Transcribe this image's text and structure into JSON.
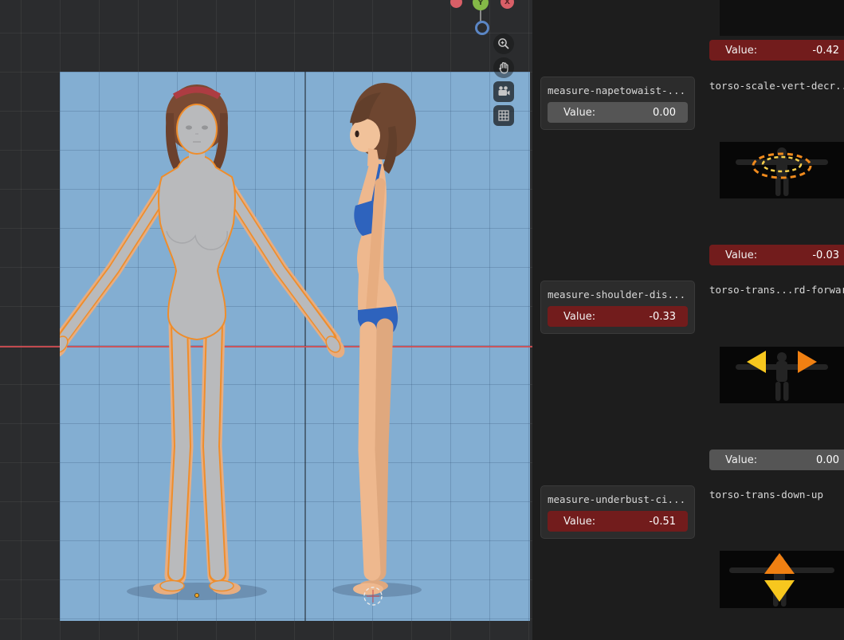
{
  "viewport": {
    "gizmo": {
      "y_label": "Y",
      "x_label": "X"
    },
    "tools": {
      "zoom": "zoom-in-icon",
      "pan": "hand-icon",
      "camera": "camera-icon",
      "grid": "grid-icon"
    }
  },
  "panels": {
    "left_column": [
      {
        "title": "measure-napetowaist-...",
        "value_label": "Value:",
        "value": "0.00",
        "state": "default"
      },
      {
        "title": "measure-shoulder-dis...",
        "value_label": "Value:",
        "value": "-0.33",
        "state": "modified"
      },
      {
        "title": "measure-underbust-ci...",
        "value_label": "Value:",
        "value": "-0.51",
        "state": "modified"
      }
    ],
    "right_column": {
      "top_slider": {
        "value_label": "Value:",
        "value": "-0.42",
        "state": "modified"
      },
      "sections": [
        {
          "title": "torso-scale-vert-decr...",
          "value_label": "Value:",
          "value": "-0.03",
          "state": "modified",
          "thumbnail": "torso-scale-vertical-thumbnail"
        },
        {
          "title": "torso-trans...rd-forwar",
          "value_label": "Value:",
          "value": "0.00",
          "state": "default",
          "thumbnail": "torso-translate-backward-forward-thumbnail"
        },
        {
          "title": "torso-trans-down-up",
          "thumbnail": "torso-translate-down-up-thumbnail"
        }
      ]
    }
  },
  "colors": {
    "slider_default": "#555555",
    "slider_modified": "#721c1c",
    "reference_background": "#83aed2",
    "axis_x_red": "#cf4d52",
    "accent_orange": "#f08a1d",
    "accent_yellow": "#f7c71e"
  }
}
